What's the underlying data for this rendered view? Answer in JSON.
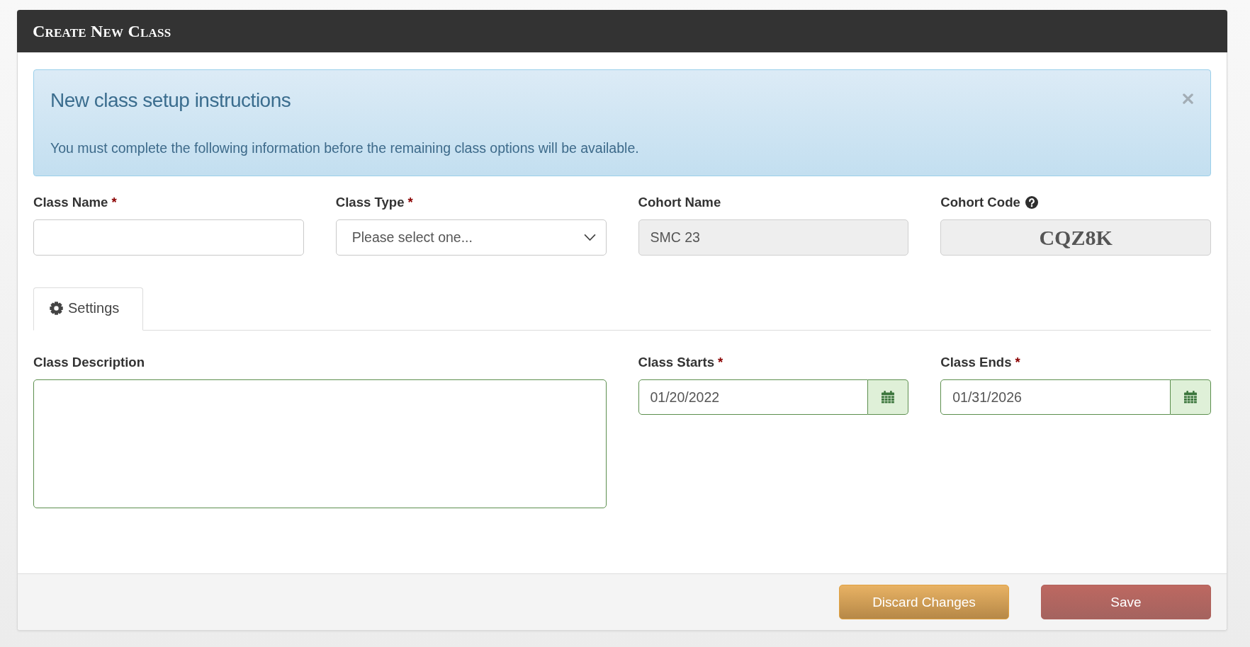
{
  "panel": {
    "title": "Create New Class"
  },
  "alert": {
    "title": "New class setup instructions",
    "message": "You must complete the following information before the remaining class options will be available."
  },
  "fields": [
    {
      "kind": "text",
      "label": "Class Name",
      "required_mark": "*"
    },
    {
      "kind": "select",
      "label": "Class Type",
      "required_mark": "*",
      "placeholder": "Please select one..."
    },
    {
      "kind": "readonly",
      "label": "Cohort Name",
      "value": "SMC 23"
    },
    {
      "kind": "code",
      "label": "Cohort Code",
      "value": "CQZ8K",
      "help": true
    }
  ],
  "tabs": [
    {
      "label": "Settings",
      "selected": true
    }
  ],
  "settings": [
    {
      "kind": "textarea",
      "label": "Class Description",
      "valid": true
    },
    {
      "kind": "date",
      "label": "Class Starts",
      "required_mark": "*",
      "value": "01/20/2022",
      "valid": true
    },
    {
      "kind": "date",
      "label": "Class Ends",
      "required_mark": "*",
      "value": "01/31/2026",
      "valid": true
    }
  ],
  "buttons": [
    {
      "label": "Discard Changes",
      "kind": "warning"
    },
    {
      "label": "Save",
      "kind": "danger"
    }
  ]
}
